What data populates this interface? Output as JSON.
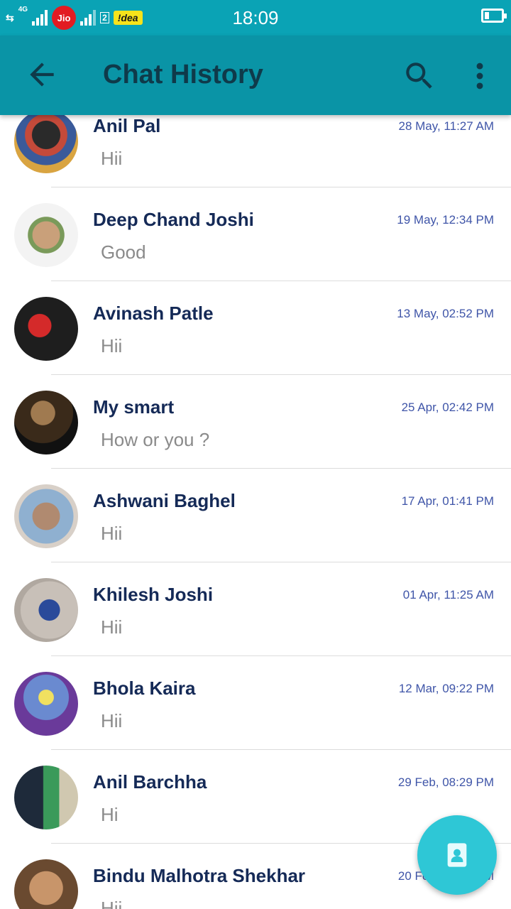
{
  "status_bar": {
    "network_type": "4G",
    "sim1_carrier": "Jio",
    "sim2_index": "2",
    "sim2_carrier": "!dea",
    "time": "18:09"
  },
  "toolbar": {
    "title": "Chat History"
  },
  "chats": [
    {
      "name": "Anil Pal",
      "time": "28 May, 11:27 AM",
      "message": "Hii"
    },
    {
      "name": "Deep Chand Joshi",
      "time": "19 May, 12:34 PM",
      "message": "Good"
    },
    {
      "name": "Avinash Patle",
      "time": "13 May, 02:52 PM",
      "message": "Hii"
    },
    {
      "name": "My smart",
      "time": "25 Apr, 02:42 PM",
      "message": "How or you ?"
    },
    {
      "name": "Ashwani Baghel",
      "time": "17 Apr, 01:41 PM",
      "message": "Hii"
    },
    {
      "name": "Khilesh Joshi",
      "time": "01 Apr, 11:25 AM",
      "message": "Hii"
    },
    {
      "name": "Bhola Kaira",
      "time": "12 Mar, 09:22 PM",
      "message": "Hii"
    },
    {
      "name": "Anil Barchha",
      "time": "29 Feb, 08:29 PM",
      "message": "Hi"
    },
    {
      "name": "Bindu Malhotra Shekhar",
      "time": "20 Feb, 04:17 PM",
      "message": "Hii"
    }
  ],
  "colors": {
    "status_bar": "#0aa3b5",
    "toolbar": "#0a94a6",
    "name_text": "#152a57",
    "time_text": "#3f55a8",
    "message_text": "#8a8a8a",
    "fab": "#2ec7d6"
  },
  "icons": {
    "back": "arrow-back-icon",
    "search": "search-icon",
    "menu": "more-vert-icon",
    "fab": "contacts-icon"
  }
}
